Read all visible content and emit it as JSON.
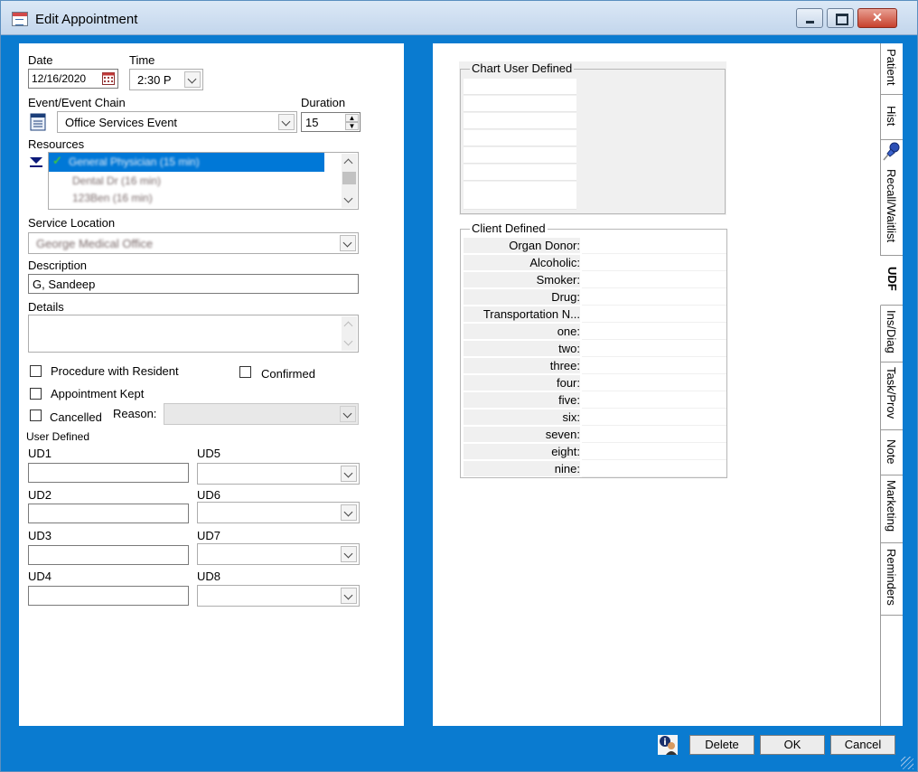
{
  "window": {
    "title": "Edit Appointment"
  },
  "left": {
    "date_label": "Date",
    "date_value": "12/16/2020",
    "time_label": "Time",
    "time_value": "2:30 P",
    "event_label": "Event/Event Chain",
    "event_value": "Office Services Event",
    "duration_label": "Duration",
    "duration_value": "15",
    "resources_label": "Resources",
    "resources": [
      "General Physician (15 min)",
      "Dental Dr (16 min)",
      "123Ben (16 min)"
    ],
    "service_location_label": "Service Location",
    "service_location_value": "George Medical Office",
    "description_label": "Description",
    "description_value": "G, Sandeep",
    "details_label": "Details",
    "details_value": "",
    "procedure_label": "Procedure with Resident",
    "confirmed_label": "Confirmed",
    "kept_label": "Appointment Kept",
    "cancelled_label": "Cancelled",
    "reason_label": "Reason:",
    "reason_value": "",
    "user_defined_label": "User Defined",
    "ud": [
      {
        "label": "UD1",
        "value": ""
      },
      {
        "label": "UD2",
        "value": ""
      },
      {
        "label": "UD3",
        "value": ""
      },
      {
        "label": "UD4",
        "value": ""
      }
    ],
    "ud_select": [
      {
        "label": "UD5",
        "value": ""
      },
      {
        "label": "UD6",
        "value": ""
      },
      {
        "label": "UD7",
        "value": ""
      },
      {
        "label": "UD8",
        "value": ""
      }
    ]
  },
  "right": {
    "chart_user_defined_title": "Chart User Defined",
    "client_defined_title": "Client Defined",
    "client_defined_fields": [
      "Organ Donor:",
      "Alcoholic:",
      "Smoker:",
      "Drug:",
      "Transportation N...",
      "one:",
      "two:",
      "three:",
      "four:",
      "five:",
      "six:",
      "seven:",
      "eight:",
      "nine:"
    ]
  },
  "tabs": [
    "Patient",
    "Hist",
    "Recall/Waitlist",
    "UDF",
    "Ins/Diag",
    "Task/Prov",
    "Note",
    "Marketing",
    "Reminders"
  ],
  "active_tab": "UDF",
  "buttons": {
    "delete": "Delete",
    "ok": "OK",
    "cancel": "Cancel"
  },
  "colors": {
    "frame": "#0a7bd0",
    "selection": "#0078d7",
    "close": "#c7412d"
  }
}
